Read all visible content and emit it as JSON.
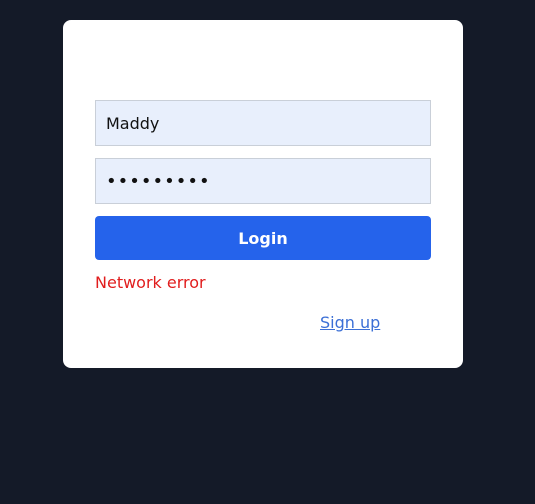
{
  "login_form": {
    "username_value": "Maddy",
    "password_value": "*********",
    "login_label": "Login",
    "error_message": "Network error",
    "signup_label": "Sign up"
  },
  "colors": {
    "background": "#141a28",
    "card": "#ffffff",
    "input_fill": "#e8effc",
    "primary_button": "#2563eb",
    "error_text": "#e11d1d",
    "link": "#3b6fd6"
  }
}
